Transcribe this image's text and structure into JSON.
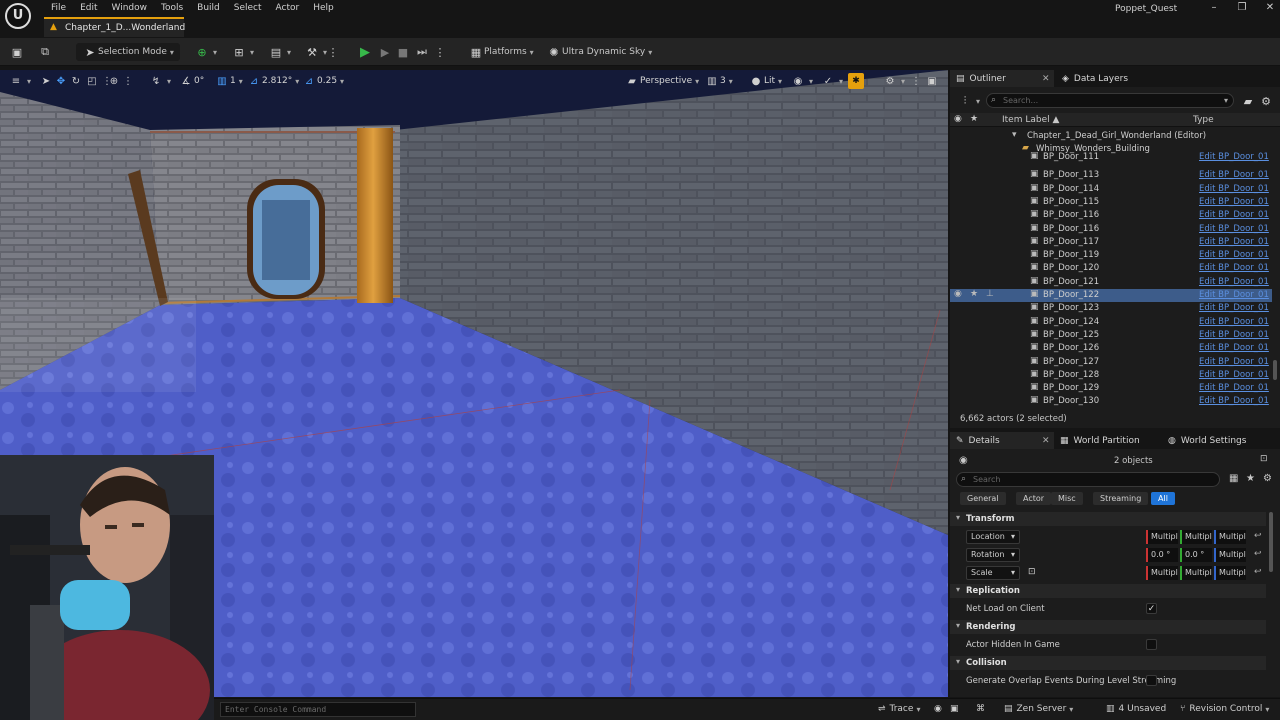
{
  "app": {
    "logo_glyph": "U",
    "project_name": "Poppet_Quest",
    "menu": [
      "File",
      "Edit",
      "Window",
      "Tools",
      "Build",
      "Select",
      "Actor",
      "Help"
    ],
    "window_controls": {
      "minimize": "–",
      "restore": "❐",
      "close": "✕"
    }
  },
  "level_tab": {
    "label": "Chapter_1_D...Wonderland"
  },
  "toolbar": {
    "mode_label": "Selection Mode",
    "platforms_label": "Platforms",
    "sky_label": "Ultra Dynamic Sky"
  },
  "viewport": {
    "rotation_snap": "0°",
    "grid_snap": "1",
    "fov": "2.812°",
    "camera_speed": "0.25",
    "view_mode": "Perspective",
    "view_count": "3",
    "lighting_mode": "Lit"
  },
  "outliner": {
    "tab_label": "Outliner",
    "data_layers_label": "Data Layers",
    "search_placeholder": "Search...",
    "col_label": "Item Label ▲",
    "col_type": "Type",
    "world_item": "Chapter_1_Dead_Girl_Wonderland (Editor)",
    "folder_item": "Whimsy_Wonders_Building",
    "rows": [
      {
        "label": "BP_Door_111",
        "type": "Edit BP_Door_01",
        "selected": false
      },
      {
        "label": "BP_Door_113",
        "type": "Edit BP_Door_01",
        "selected": false
      },
      {
        "label": "BP_Door_114",
        "type": "Edit BP_Door_01",
        "selected": false
      },
      {
        "label": "BP_Door_115",
        "type": "Edit BP_Door_01",
        "selected": false
      },
      {
        "label": "BP_Door_116",
        "type": "Edit BP_Door_01",
        "selected": false
      },
      {
        "label": "BP_Door_116",
        "type": "Edit BP_Door_01",
        "selected": false
      },
      {
        "label": "BP_Door_117",
        "type": "Edit BP_Door_01",
        "selected": false
      },
      {
        "label": "BP_Door_119",
        "type": "Edit BP_Door_01",
        "selected": false
      },
      {
        "label": "BP_Door_120",
        "type": "Edit BP_Door_01",
        "selected": false
      },
      {
        "label": "BP_Door_121",
        "type": "Edit BP_Door_01",
        "selected": false
      },
      {
        "label": "BP_Door_122",
        "type": "Edit BP_Door_01",
        "selected": true
      },
      {
        "label": "BP_Door_123",
        "type": "Edit BP_Door_01",
        "selected": false
      },
      {
        "label": "BP_Door_124",
        "type": "Edit BP_Door_01",
        "selected": false
      },
      {
        "label": "BP_Door_125",
        "type": "Edit BP_Door_01",
        "selected": false
      },
      {
        "label": "BP_Door_126",
        "type": "Edit BP_Door_01",
        "selected": false
      },
      {
        "label": "BP_Door_127",
        "type": "Edit BP_Door_01",
        "selected": false
      },
      {
        "label": "BP_Door_128",
        "type": "Edit BP_Door_01",
        "selected": false
      },
      {
        "label": "BP_Door_129",
        "type": "Edit BP_Door_01",
        "selected": false
      },
      {
        "label": "BP_Door_130",
        "type": "Edit BP_Door_01",
        "selected": false
      }
    ],
    "actor_count": "6,662 actors (2 selected)"
  },
  "details": {
    "tab_label": "Details",
    "world_partition_label": "World Partition",
    "world_settings_label": "World Settings",
    "objects_count": "2 objects",
    "search_placeholder": "Search",
    "filters": [
      "General",
      "Actor",
      "Misc",
      "Streaming",
      "All"
    ],
    "active_filter": "All",
    "transform": {
      "section": "Transform",
      "location_label": "Location",
      "rotation_label": "Rotation",
      "scale_label": "Scale",
      "location_values": [
        "Multipl",
        "Multipl",
        "Multipl"
      ],
      "rotation_values": [
        "0.0 °",
        "0.0 °",
        "Multipl"
      ],
      "scale_values": [
        "Multipl",
        "Multipl",
        "Multipl"
      ]
    },
    "replication": {
      "section": "Replication",
      "net_load_label": "Net Load on Client",
      "net_load_checked": true
    },
    "rendering": {
      "section": "Rendering",
      "hidden_label": "Actor Hidden In Game",
      "hidden_checked": false
    },
    "collision": {
      "section": "Collision",
      "overlap_label": "Generate Overlap Events During Level Streaming",
      "overlap_checked": false
    }
  },
  "statusbar": {
    "console_placeholder": "Enter Console Command",
    "trace_label": "Trace",
    "zen_label": "Zen Server",
    "unsaved_label": "4 Unsaved",
    "revision_label": "Revision Control"
  },
  "colors": {
    "accent": "#e5a00d",
    "selection": "#3d5c8a",
    "link": "#5a8fe0",
    "filter_active": "#1f74d8"
  }
}
